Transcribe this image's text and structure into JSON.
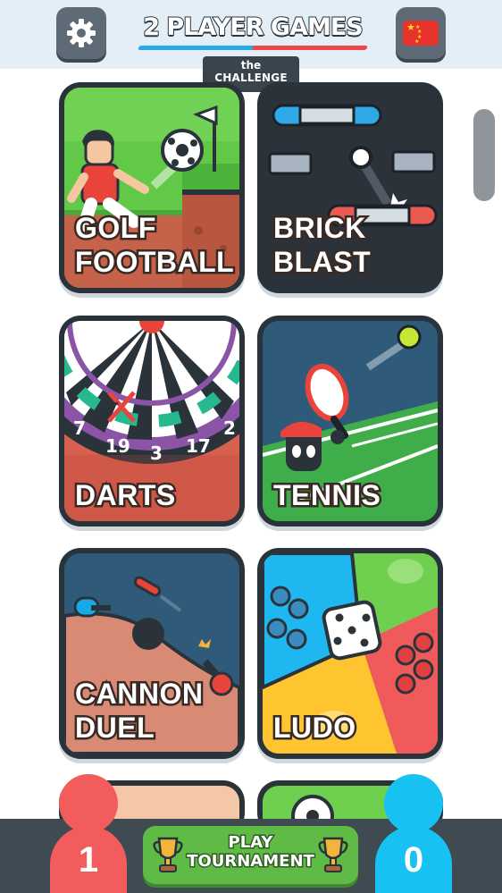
{
  "header": {
    "title": "2 PLAYER GAMES",
    "badge_the": "the",
    "badge_challenge": "CHALLENGE",
    "settings_icon": "gear-icon",
    "language_icon": "china-flag-icon"
  },
  "games": [
    {
      "title": "GOLF\nFOOTBALL"
    },
    {
      "title": "BRICK\nBLAST"
    },
    {
      "title": "DARTS",
      "dart_numbers": [
        "7",
        "19",
        "3",
        "17",
        "2"
      ]
    },
    {
      "title": "TENNIS"
    },
    {
      "title": "CANNON\nDUEL"
    },
    {
      "title": "LUDO"
    }
  ],
  "bottom_bar": {
    "player_red_score": "1",
    "player_blue_score": "0",
    "play_button_line1": "PLAY",
    "play_button_line2": "TOURNAMENT"
  },
  "colors": {
    "player_red": "#f25c5c",
    "player_blue": "#17c1f2",
    "play_button": "#5fbb46",
    "header_bg": "#e4eef6",
    "card_border": "#2a323a"
  }
}
